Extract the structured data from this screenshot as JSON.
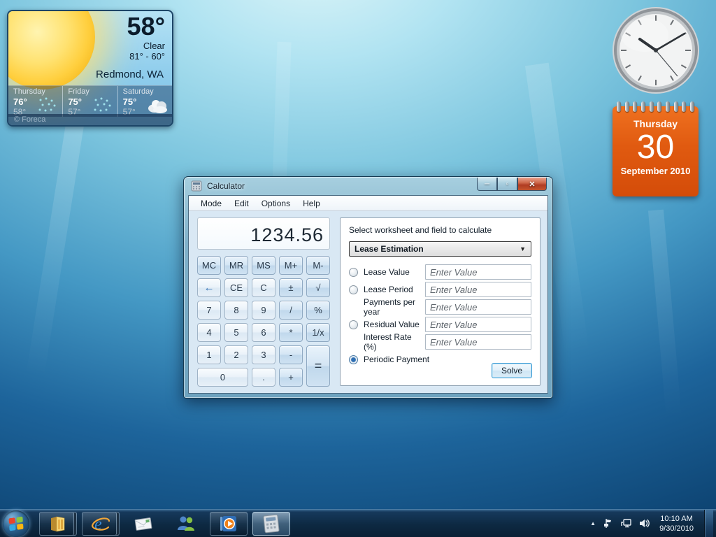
{
  "weather": {
    "current_temp": "58°",
    "condition": "Clear",
    "range": "81°  -  60°",
    "location": "Redmond, WA",
    "forecast": [
      {
        "day": "Thursday",
        "high": "76°",
        "low": "58°",
        "icon": "rain-icon"
      },
      {
        "day": "Friday",
        "high": "75°",
        "low": "57°",
        "icon": "rain-icon"
      },
      {
        "day": "Saturday",
        "high": "75°",
        "low": "57°",
        "icon": "cloud-icon"
      }
    ],
    "attribution": "© Foreca"
  },
  "clock": {
    "time_shown": "10:10",
    "hour_angle_deg": 305,
    "minute_angle_deg": 60,
    "second_angle_deg": 140
  },
  "calendar": {
    "weekday": "Thursday",
    "day": "30",
    "month_year": "September 2010"
  },
  "calculator": {
    "window_title": "Calculator",
    "caption": {
      "minimize": "─",
      "maximize": "▫",
      "close": "✕"
    },
    "menus": [
      "Mode",
      "Edit",
      "Options",
      "Help"
    ],
    "display_value": "1234.56",
    "keys": [
      {
        "label": "MC"
      },
      {
        "label": "MR"
      },
      {
        "label": "MS"
      },
      {
        "label": "M+"
      },
      {
        "label": "M-"
      },
      {
        "label": "←"
      },
      {
        "label": "CE"
      },
      {
        "label": "C"
      },
      {
        "label": "±"
      },
      {
        "label": "√"
      },
      {
        "label": "7"
      },
      {
        "label": "8"
      },
      {
        "label": "9"
      },
      {
        "label": "/"
      },
      {
        "label": "%"
      },
      {
        "label": "4"
      },
      {
        "label": "5"
      },
      {
        "label": "6"
      },
      {
        "label": "*"
      },
      {
        "label": "1/x"
      },
      {
        "label": "1"
      },
      {
        "label": "2"
      },
      {
        "label": "3"
      },
      {
        "label": "-"
      },
      {
        "label": "="
      },
      {
        "label": "0"
      },
      {
        "label": "."
      },
      {
        "label": "+"
      }
    ],
    "worksheet": {
      "prompt": "Select worksheet and field to calculate",
      "selected_worksheet": "Lease Estimation",
      "fields": [
        {
          "label": "Lease Value",
          "has_radio": true,
          "radio_selected": false,
          "placeholder": "Enter Value"
        },
        {
          "label": "Lease Period",
          "has_radio": true,
          "radio_selected": false,
          "placeholder": "Enter Value"
        },
        {
          "label": "Payments per year",
          "has_radio": false,
          "placeholder": "Enter Value"
        },
        {
          "label": "Residual Value",
          "has_radio": true,
          "radio_selected": false,
          "placeholder": "Enter Value"
        },
        {
          "label": "Interest Rate (%)",
          "has_radio": false,
          "placeholder": "Enter Value"
        },
        {
          "label": "Periodic Payment",
          "has_radio": true,
          "radio_selected": true
        }
      ],
      "solve_label": "Solve"
    }
  },
  "taskbar": {
    "apps": [
      {
        "name": "windows-explorer",
        "state": "open-stacked"
      },
      {
        "name": "internet-explorer",
        "state": "open-stacked"
      },
      {
        "name": "mail",
        "state": "pinned"
      },
      {
        "name": "messenger",
        "state": "pinned"
      },
      {
        "name": "windows-media-player",
        "state": "open"
      },
      {
        "name": "calculator",
        "state": "active"
      }
    ],
    "tray": {
      "time": "10:10 AM",
      "date": "9/30/2010"
    }
  },
  "colors": {
    "desktop_top": "#def5f8",
    "desktop_bottom": "#0c416f",
    "taskbar": "#0d2942",
    "calendar_orange": "#e05a10",
    "close_button_red": "#b03c22",
    "accent_blue": "#2f6fb3"
  }
}
